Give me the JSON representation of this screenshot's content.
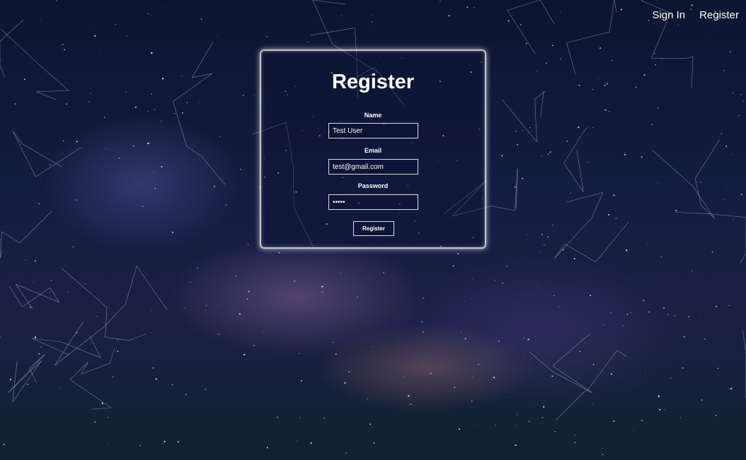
{
  "nav": {
    "sign_in": "Sign In",
    "register": "Register"
  },
  "form": {
    "title": "Register",
    "name_label": "Name",
    "name_value": "Test User",
    "email_label": "Email",
    "email_value": "test@gmail.com",
    "password_label": "Password",
    "password_value": "•••••",
    "submit_label": "Register"
  },
  "colors": {
    "text": "#ffffff",
    "background": "#141d44",
    "constellation_lines": "#c8cce8"
  }
}
